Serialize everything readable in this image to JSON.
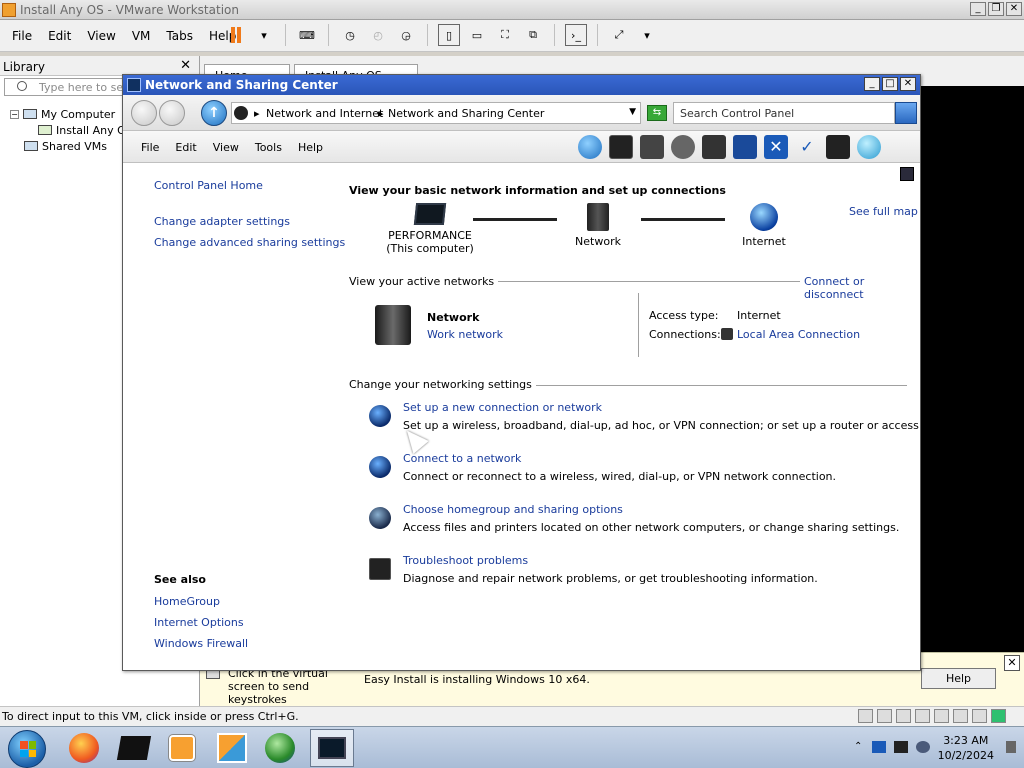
{
  "vmware": {
    "title": "Install Any OS - VMware Workstation",
    "menu": [
      "File",
      "Edit",
      "View",
      "VM",
      "Tabs",
      "Help"
    ],
    "library": {
      "header": "Library",
      "search_placeholder": "Type here to sea",
      "tree": [
        {
          "label": "My Computer"
        },
        {
          "label": "Install Any O"
        },
        {
          "label": "Shared VMs"
        }
      ]
    },
    "tabs": [
      {
        "label": "Home"
      },
      {
        "label": "Install Any OS"
      }
    ],
    "hint": {
      "text": "Click in the virtual screen to send keystrokes",
      "install_status": "Easy Install is installing Windows 10 x64.",
      "help_button": "Help"
    },
    "statusbar": {
      "message": "To direct input to this VM, click inside or press Ctrl+G."
    }
  },
  "nsc": {
    "title": "Network and Sharing Center",
    "breadcrumb": [
      "Network and Internet",
      "Network and Sharing Center"
    ],
    "search_placeholder": "Search Control Panel",
    "menu": [
      "File",
      "Edit",
      "View",
      "Tools",
      "Help"
    ],
    "left_links": [
      "Control Panel Home",
      "Change adapter settings",
      "Change advanced sharing settings"
    ],
    "see_also": {
      "heading": "See also",
      "links": [
        "HomeGroup",
        "Internet Options",
        "Windows Firewall"
      ]
    },
    "heading": "View your basic network information and set up connections",
    "see_full_map": "See full map",
    "map": {
      "computer_name": "PERFORMANCE",
      "computer_sub": "(This computer)",
      "network": "Network",
      "internet": "Internet"
    },
    "active_networks": {
      "label": "View your active networks",
      "connect_disconnect": "Connect or disconnect",
      "name": "Network",
      "type": "Work network",
      "access_type_label": "Access type:",
      "access_type_value": "Internet",
      "connections_label": "Connections:",
      "connections_value": "Local Area Connection"
    },
    "change_settings": {
      "label": "Change your networking settings",
      "tasks": [
        {
          "title": "Set up a new connection or network",
          "desc": "Set up a wireless, broadband, dial-up, ad hoc, or VPN connection; or set up a router or access point."
        },
        {
          "title": "Connect to a network",
          "desc": "Connect or reconnect to a wireless, wired, dial-up, or VPN network connection."
        },
        {
          "title": "Choose homegroup and sharing options",
          "desc": "Access files and printers located on other network computers, or change sharing settings."
        },
        {
          "title": "Troubleshoot problems",
          "desc": "Diagnose and repair network problems, or get troubleshooting information."
        }
      ]
    }
  },
  "taskbar": {
    "time": "3:23 AM",
    "date": "10/2/2024"
  }
}
